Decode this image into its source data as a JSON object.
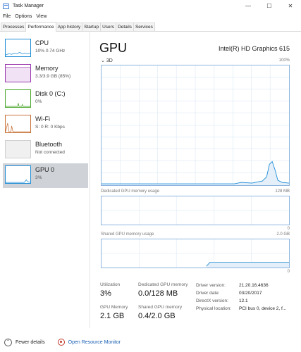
{
  "window": {
    "title": "Task Manager",
    "controls": [
      "—",
      "☐",
      "✕"
    ]
  },
  "menu": [
    "File",
    "Options",
    "View"
  ],
  "tabs": [
    {
      "label": "Processes",
      "active": false
    },
    {
      "label": "Performance",
      "active": true
    },
    {
      "label": "App history",
      "active": false
    },
    {
      "label": "Startup",
      "active": false
    },
    {
      "label": "Users",
      "active": false
    },
    {
      "label": "Details",
      "active": false
    },
    {
      "label": "Services",
      "active": false
    }
  ],
  "sidebar": [
    {
      "name": "CPU",
      "sub": "10% 0.74 GHz",
      "color": "#1f8dd6",
      "active": false
    },
    {
      "name": "Memory",
      "sub": "3.3/3.9 GB (85%)",
      "color": "#9b39b0",
      "active": false
    },
    {
      "name": "Disk 0 (C:)",
      "sub": "0%",
      "color": "#4ea72e",
      "active": false
    },
    {
      "name": "Wi-Fi",
      "sub": "S: 0 R: 0 Kbps",
      "color": "#c8743a",
      "active": false
    },
    {
      "name": "Bluetooth",
      "sub": "Not connected",
      "color": "#cfcfcf",
      "active": false
    },
    {
      "name": "GPU 0",
      "sub": "3%",
      "color": "#1f8dd6",
      "active": true
    }
  ],
  "main": {
    "title": "GPU",
    "device": "Intel(R) HD Graphics 615",
    "engine": "3D",
    "engine_max": "100%",
    "dedicated_caption": "Dedicated GPU memory usage",
    "dedicated_max": "128 MB",
    "dedicated_min": "0",
    "shared_caption": "Shared GPU memory usage",
    "shared_max": "2.0 GB",
    "shared_min": "0"
  },
  "stats": {
    "utilization_label": "Utilization",
    "utilization_value": "3%",
    "dedicated_label": "Dedicated GPU memory",
    "dedicated_value": "0.0/128 MB",
    "gpu_memory_label": "GPU Memory",
    "gpu_memory_value": "2.1 GB",
    "shared_label": "Shared GPU memory",
    "shared_value": "0.4/2.0 GB"
  },
  "info": [
    {
      "key": "Driver version:",
      "value": "21.20.16.4636"
    },
    {
      "key": "Driver date:",
      "value": "03/20/2017"
    },
    {
      "key": "DirectX version:",
      "value": "12.1"
    },
    {
      "key": "Physical location:",
      "value": "PCI bus 0, device 2, f..."
    }
  ],
  "footer": {
    "fewer_details": "Fewer details",
    "open_monitor": "Open Resource Monitor"
  }
}
